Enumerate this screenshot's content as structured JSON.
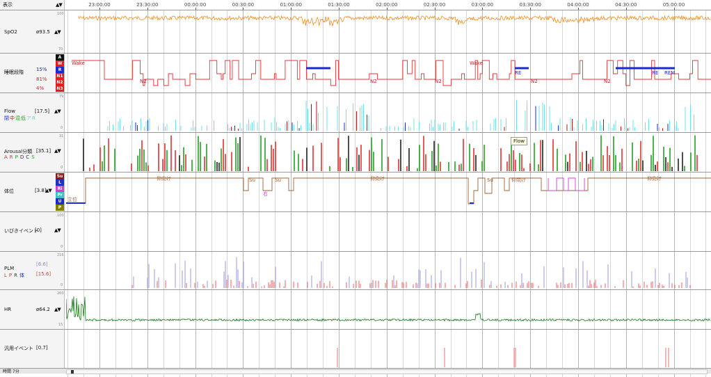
{
  "header": {
    "display_label": "表示",
    "sort_icon": "▲▼"
  },
  "timeline": {
    "labels": [
      "23:00:00",
      "23:30:00",
      "00:00:00",
      "00:30:00",
      "01:00:00",
      "01:30:00",
      "02:00:00",
      "02:30:00",
      "03:00:00",
      "03:30:00",
      "04:00:00",
      "04:30:00",
      "05:00:00"
    ]
  },
  "channels": {
    "spo2": {
      "name": "SpO2",
      "value": "ø93.5",
      "axis_max": "100",
      "axis_min": "70",
      "color": "#f08c1e"
    },
    "stage": {
      "name": "睡眠段階",
      "pct1": "15%",
      "pct2": "81%",
      "pct3": "4%",
      "codes": [
        "A",
        "W",
        "R",
        "N1",
        "N2",
        "N3"
      ],
      "annotations": [
        "Wake",
        "N2",
        "N2",
        "N2",
        "Wake",
        "RE",
        "N2",
        "N2",
        "RE",
        "REM"
      ],
      "color": "#e83030",
      "rem_color": "#1a2ad0"
    },
    "flow": {
      "name": "Flow",
      "value": "[17.5]",
      "legend": [
        "閉",
        "中",
        "混",
        "低",
        "ア",
        "R"
      ],
      "legend_colors": [
        "#1a2ad0",
        "#c01010",
        "#20a020",
        "#20a020",
        "#70d0d0",
        "#70d0d0"
      ],
      "axis_max": "79",
      "axis_min": "0",
      "color": "#70e0e8"
    },
    "arousal": {
      "name": "Arousal分類",
      "value": "[35.1]",
      "legend": [
        "A",
        "R",
        "P",
        "D",
        "C",
        "S"
      ],
      "legend_colors": [
        "#e03030",
        "#e03030",
        "#20a020",
        "#303030",
        "#303030",
        "#20a020"
      ],
      "axis_max": "31",
      "axis_min": "0",
      "tooltip": "Flow"
    },
    "position": {
      "name": "体位",
      "value": "[3.8]",
      "codes": [
        "Su",
        "L",
        "Ri",
        "Pr",
        "U",
        "P"
      ],
      "code_colors": [
        "#8a1a1a",
        "#2030c0",
        "#d040d0",
        "#40c0c0",
        "#1a2ad0",
        "#808000"
      ],
      "annotations": [
        "立位",
        "仰向け",
        "Su",
        "右",
        "Su",
        "仰向け",
        "Su",
        "仰向け",
        "仰向け"
      ],
      "color": "#a06030"
    },
    "snore": {
      "name": "いびきイベント",
      "value": "[0]",
      "axis_max": "100",
      "axis_min": "0"
    },
    "plm": {
      "name": "PLM",
      "value1": "[6.6]",
      "value2": "[15.6]",
      "legend": [
        "L",
        "P",
        "R",
        "体"
      ],
      "axis_max": "216",
      "axis_min": "0"
    },
    "hr": {
      "name": "HR",
      "value": "ø64.2",
      "axis_max": "260",
      "axis_min": "15",
      "color": "#1a7a1a"
    },
    "general": {
      "name": "汎用イベント",
      "value": "[0.7]"
    }
  },
  "footer": {
    "label": "時間 7分"
  }
}
